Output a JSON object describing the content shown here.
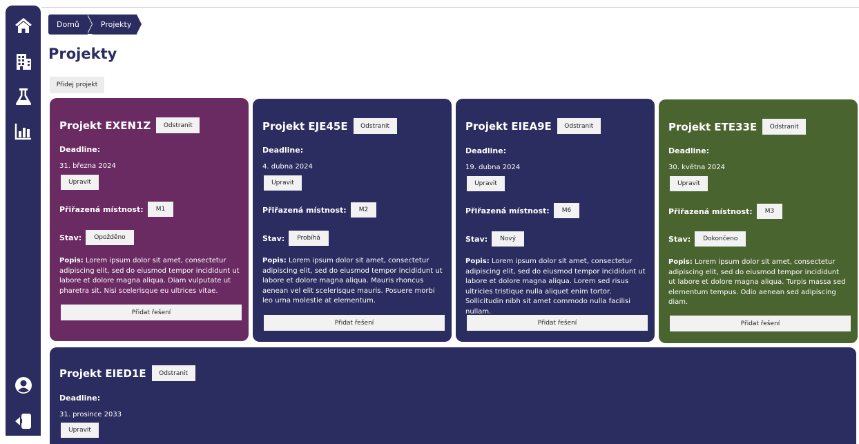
{
  "colors": {
    "sidebar": "#2b2c5f",
    "card_purple": "#6a2a62",
    "card_navy": "#2b2c5f",
    "card_green": "#4a6430",
    "button": "#f2f2f2"
  },
  "sidebar": {
    "items": [
      {
        "icon": "home-icon"
      },
      {
        "icon": "building-icon"
      },
      {
        "icon": "flask-icon"
      },
      {
        "icon": "bar-chart-icon"
      },
      {
        "icon": "user-icon"
      },
      {
        "icon": "logout-icon"
      }
    ]
  },
  "breadcrumb": [
    "Domů",
    "Projekty"
  ],
  "page_title": "Projekty",
  "add_project_label": "Přidej projekt",
  "labels": {
    "remove": "Odstranit",
    "deadline": "Deadline:",
    "edit": "Upravit",
    "room": "Přiřazená místnost:",
    "status": "Stav:",
    "description": "Popis:",
    "add_solution": "Přidat řešení"
  },
  "projects": [
    {
      "name": "Projekt EXEN1Z",
      "deadline": "31. března 2024",
      "room": "M1",
      "status": "Opožděno",
      "description": "Lorem ipsum dolor sit amet, consectetur adipiscing elit, sed do eiusmod tempor incididunt ut labore et dolore magna aliqua. Diam vulputate ut pharetra sit. Nisi scelerisque eu ultrices vitae."
    },
    {
      "name": "Projekt EJE45E",
      "deadline": "4. dubna 2024",
      "room": "M2",
      "status": "Probíhá",
      "description": "Lorem ipsum dolor sit amet, consectetur adipiscing elit, sed do eiusmod tempor incididunt ut labore et dolore magna aliqua. Mauris rhoncus aenean vel elit scelerisque mauris. Posuere morbi leo urna molestie at elementum."
    },
    {
      "name": "Projekt EIEA9E",
      "deadline": "19. dubna 2024",
      "room": "M6",
      "status": "Nový",
      "description": "Lorem ipsum dolor sit amet, consectetur adipiscing elit, sed do eiusmod tempor incididunt ut labore et dolore magna aliqua. Lorem sed risus ultricies tristique nulla aliquet enim tortor. Sollicitudin nibh sit amet commodo nulla facilisi nullam."
    },
    {
      "name": "Projekt ETE33E",
      "deadline": "30. května 2024",
      "room": "M3",
      "status": "Dokončeno",
      "description": "Lorem ipsum dolor sit amet, consectetur adipiscing elit, sed do eiusmod tempor incididunt ut labore et dolore magna aliqua. Turpis massa sed elementum tempus. Odio aenean sed adipiscing diam."
    },
    {
      "name": "Projekt EIED1E",
      "deadline": "31. prosince 2033"
    }
  ]
}
